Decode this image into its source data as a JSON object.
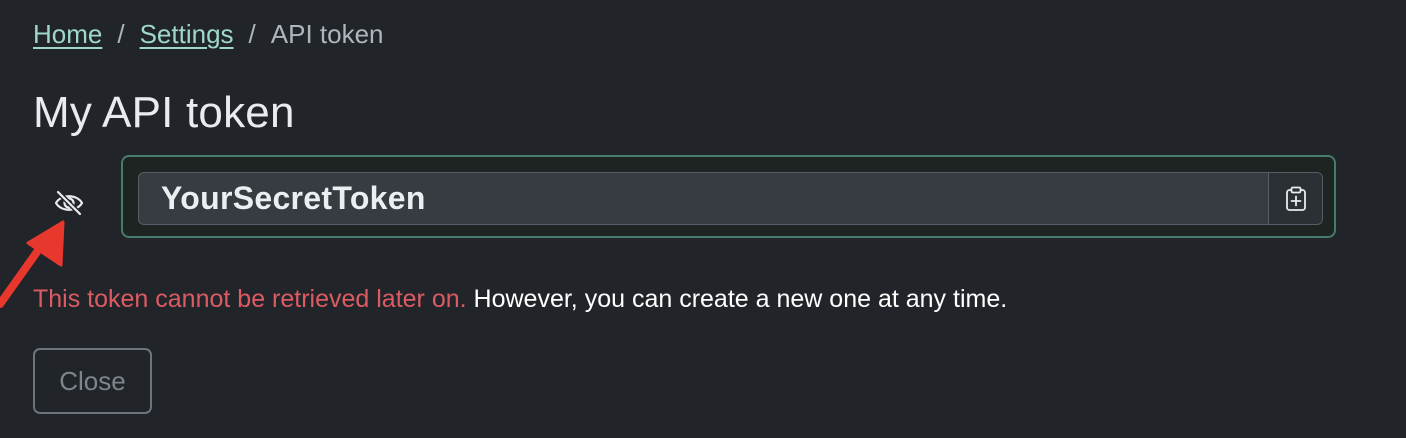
{
  "breadcrumb": {
    "items": [
      {
        "label": "Home"
      },
      {
        "label": "Settings"
      },
      {
        "label": "API token"
      }
    ],
    "separator": "/"
  },
  "page": {
    "title": "My API token"
  },
  "token": {
    "value": "YourSecretToken",
    "visibility_icon": "eye-slash-icon",
    "copy_icon": "clipboard-plus-icon"
  },
  "message": {
    "warning": "This token cannot be retrieved later on.",
    "info": " However, you can create a new one at any time."
  },
  "actions": {
    "close_label": "Close"
  },
  "annotation": {
    "arrow_icon": "red-arrow-icon"
  },
  "colors": {
    "background": "#212529",
    "link": "#9fd8cb",
    "warning": "#dc5b63",
    "token_border": "#4a7a6a",
    "arrow": "#e8382d"
  }
}
